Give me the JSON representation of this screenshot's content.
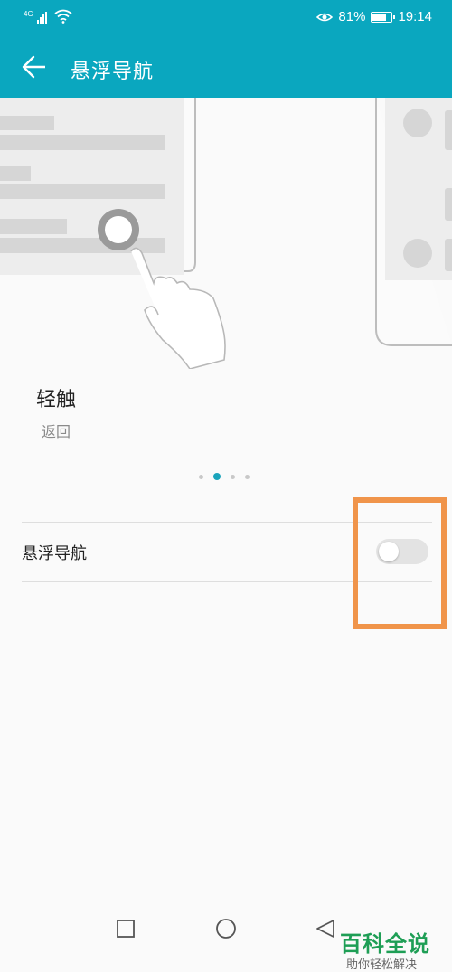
{
  "status_bar": {
    "network": "4G",
    "battery_percent": "81%",
    "battery_level": 0.81,
    "time": "19:14",
    "icons": [
      "signal-icon",
      "wifi-icon",
      "eye-comfort-icon",
      "battery-icon"
    ]
  },
  "app_bar": {
    "title": "悬浮导航",
    "back_icon": "arrow-left-icon"
  },
  "carousel": {
    "title": "轻触",
    "subtitle": "返回",
    "page_count": 4,
    "active_index": 1
  },
  "setting_row": {
    "label": "悬浮导航",
    "toggle_on": false
  },
  "nav_bar": {
    "buttons": [
      "recent-apps-icon",
      "home-icon",
      "back-triangle-icon"
    ]
  },
  "watermark": {
    "title": "百科全说",
    "subtitle": "助你轻松解决"
  },
  "colors": {
    "accent": "#0aa7bf",
    "highlight": "#f0944a",
    "toggle_off": "#e3e3e3"
  }
}
